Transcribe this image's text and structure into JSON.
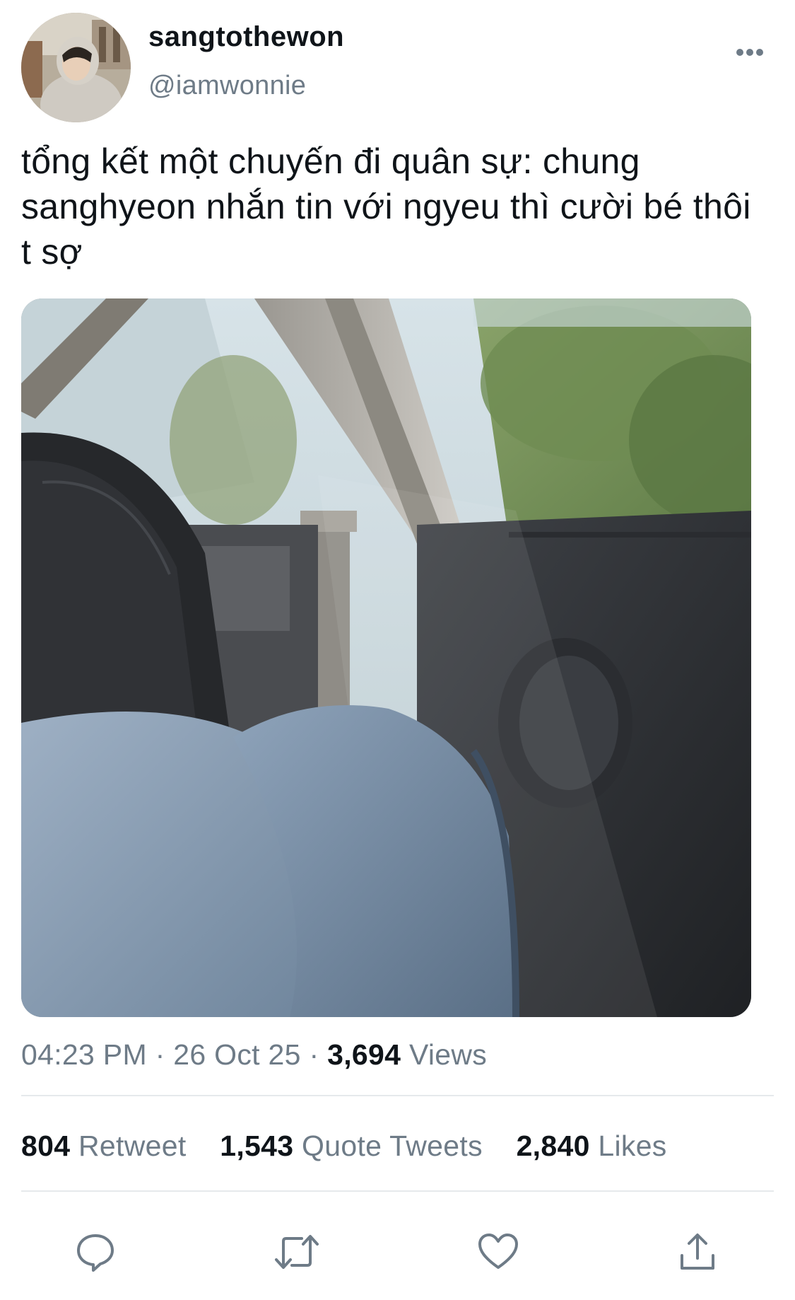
{
  "tweet": {
    "display_name": "sangtothewon",
    "handle": "@iamwonnie",
    "text": "tổng kết một chuyến đi quân sự: chung sanghyeon nhắn tin với ngyeu thì cười bé thôi t sợ",
    "time": "04:23 PM",
    "date": "26 Oct 25",
    "separator": "·",
    "views_count": "3,694",
    "views_label": "Views"
  },
  "stats": {
    "retweets_count": "804",
    "retweets_label": "Retweet",
    "quotes_count": "1,543",
    "quotes_label": "Quote Tweets",
    "likes_count": "2,840",
    "likes_label": "Likes"
  },
  "icons": {
    "more": "more-horizontal-icon",
    "reply": "reply-icon",
    "retweet": "retweet-icon",
    "like": "heart-icon",
    "share": "share-icon"
  },
  "colors": {
    "text_primary": "#0f1419",
    "text_secondary": "#6e7b87",
    "divider": "#e6e9ec",
    "icon": "#6e7b87"
  }
}
